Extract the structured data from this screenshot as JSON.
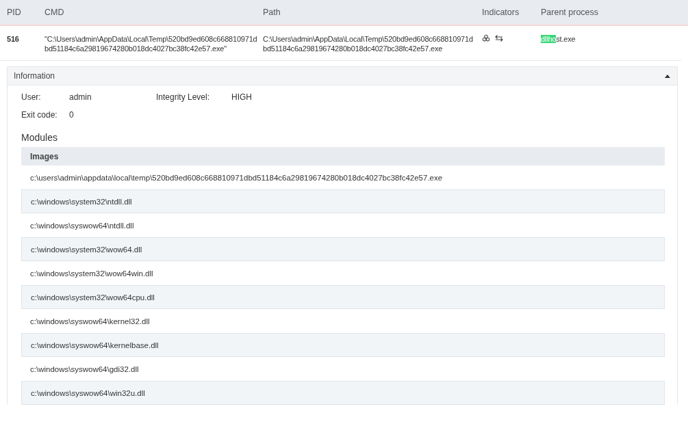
{
  "table": {
    "columns": [
      "PID",
      "CMD",
      "Path",
      "Indicators",
      "Parent process"
    ],
    "row": {
      "pid": "516",
      "cmd": "\"C:\\Users\\admin\\AppData\\Local\\Temp\\520bd9ed608c668810971dbd51184c6a29819674280b018dc4027bc38fc42e57.exe\"",
      "path": "C:\\Users\\admin\\AppData\\Local\\Temp\\520bd9ed608c668810971dbd51184c6a29819674280b018dc4027bc38fc42e57.exe",
      "indicators": [
        {
          "kind": "biohazard"
        },
        {
          "kind": "exchange"
        }
      ],
      "parent_process": {
        "match": "dllho",
        "rest": "st.exe"
      }
    }
  },
  "information": {
    "title": "Information",
    "expanded": true,
    "fields": [
      {
        "label": "User:",
        "value": "admin"
      },
      {
        "label": "Integrity Level:",
        "value": "HIGH"
      },
      {
        "label": "Exit code:",
        "value": "0"
      }
    ],
    "modules_title": "Modules",
    "images_header": "Images",
    "images": [
      "c:\\users\\admin\\appdata\\local\\temp\\520bd9ed608c668810971dbd51184c6a29819674280b018dc4027bc38fc42e57.exe",
      "c:\\windows\\system32\\ntdll.dll",
      "c:\\windows\\syswow64\\ntdll.dll",
      "c:\\windows\\system32\\wow64.dll",
      "c:\\windows\\system32\\wow64win.dll",
      "c:\\windows\\system32\\wow64cpu.dll",
      "c:\\windows\\syswow64\\kernel32.dll",
      "c:\\windows\\syswow64\\kernelbase.dll",
      "c:\\windows\\syswow64\\gdi32.dll",
      "c:\\windows\\syswow64\\win32u.dll"
    ]
  }
}
